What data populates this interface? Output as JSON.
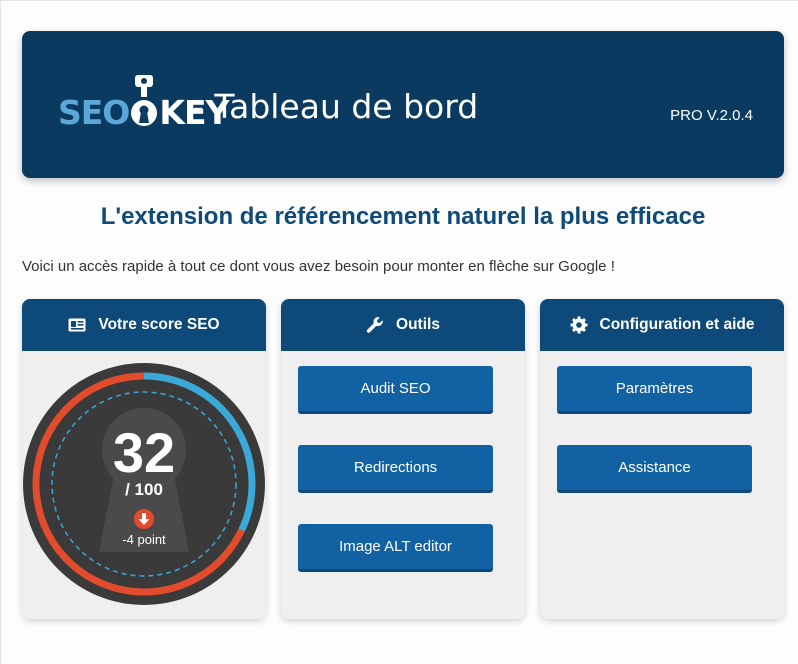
{
  "header": {
    "logo_seo": "SEO",
    "logo_key": "KEY",
    "title": "- Tableau de bord",
    "version": "PRO V.2.0.4"
  },
  "tagline": "L'extension de référencement naturel la plus efficace",
  "intro": "Voici un accès rapide à tout ce dont vous avez besoin pour monter en flèche sur Google !",
  "score_card": {
    "title": "Votre score SEO",
    "score": "32",
    "max": "/ 100",
    "change": "-4 point",
    "score_fraction": 0.32,
    "colors": {
      "progress": "#3aa9d8",
      "remainder": "#e24b2b",
      "dial": "#3a3a3a"
    }
  },
  "tools_card": {
    "title": "Outils",
    "buttons": [
      "Audit SEO",
      "Redirections",
      "Image ALT editor"
    ]
  },
  "config_card": {
    "title": "Configuration et aide",
    "buttons": [
      "Paramètres",
      "Assistance"
    ]
  },
  "colors": {
    "header_bg": "#0a3a60",
    "card_header_bg": "#0d4a7a",
    "button_bg": "#1262a3",
    "tagline": "#0e4a7a"
  },
  "icons": {
    "score": "id-card-icon",
    "tools": "wrench-icon",
    "config": "gear-icon",
    "change": "arrow-down-circle-icon"
  }
}
